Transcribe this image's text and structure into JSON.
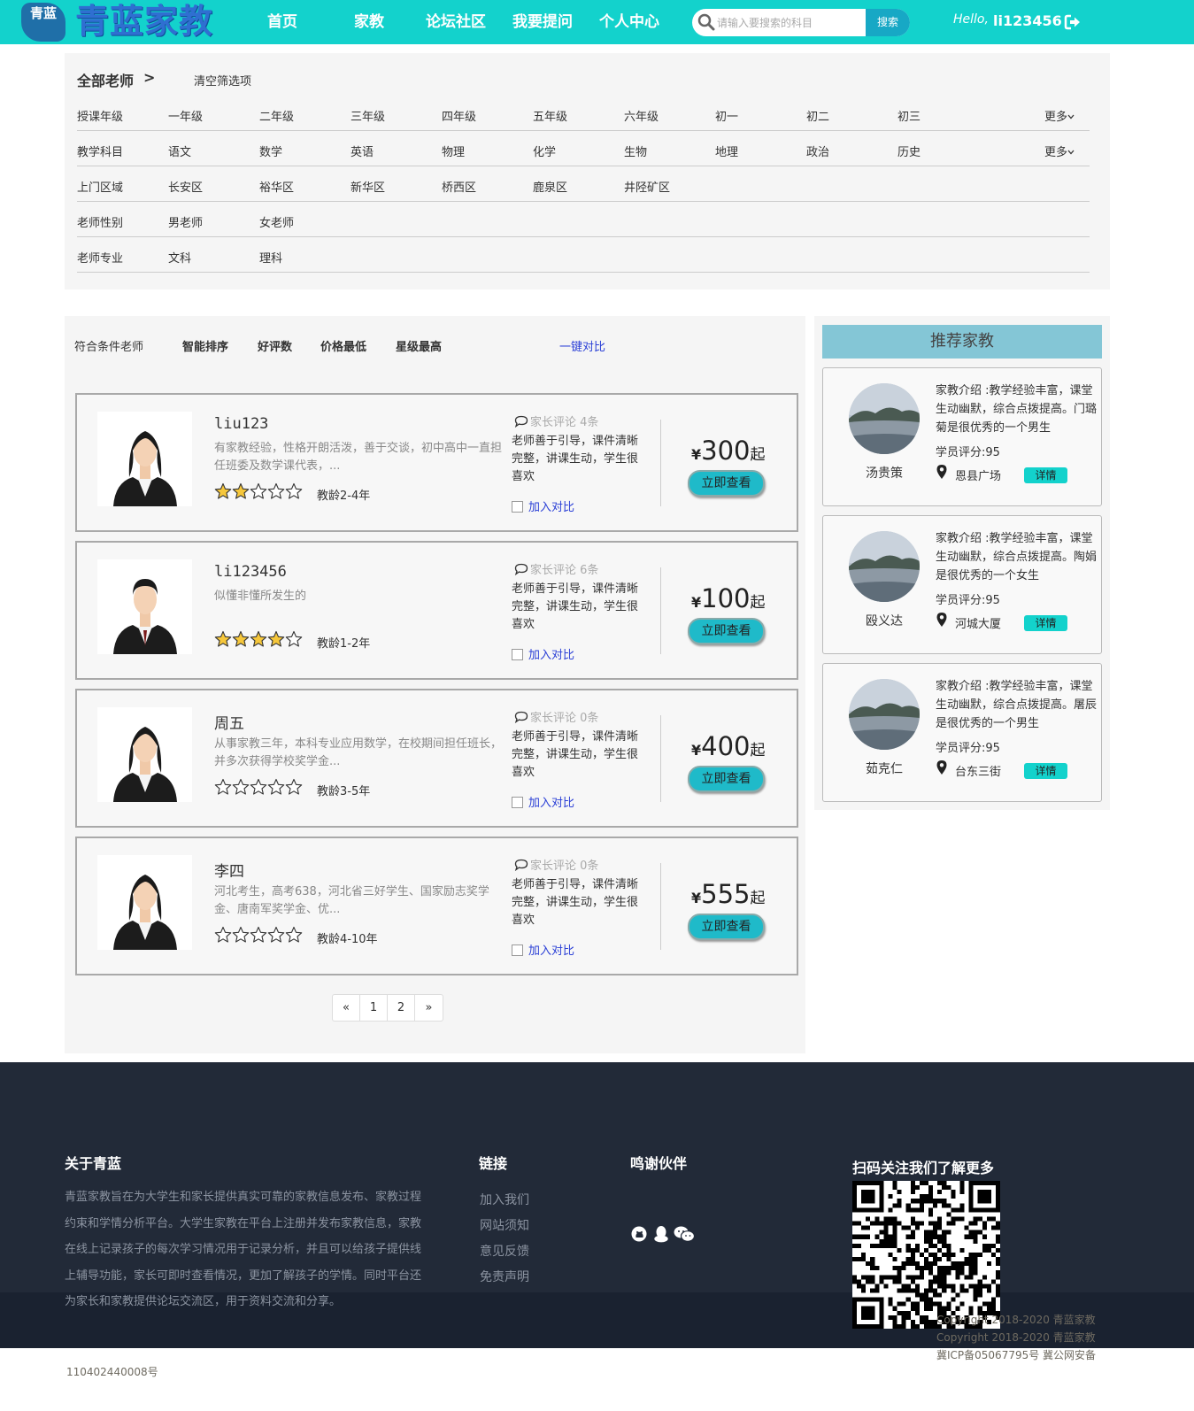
{
  "header": {
    "logo_badge": "青蓝",
    "logo_text": "青蓝家教",
    "nav": [
      "首页",
      "家教",
      "论坛社区",
      "我要提问",
      "个人中心"
    ],
    "search_placeholder": "请输入要搜索的科目",
    "search_button": "搜索",
    "hello": "Hello,",
    "username": "li123456",
    "colors": {
      "bar": "#13d2cc",
      "search_button": "#17a8c5"
    }
  },
  "filters": {
    "all_label": "全部老师",
    "arrow": ">",
    "clear": "清空筛选项",
    "more": "更多",
    "rows": [
      {
        "label": "授课年级",
        "options": [
          "一年级",
          "二年级",
          "三年级",
          "四年级",
          "五年级",
          "六年级",
          "初一",
          "初二",
          "初三"
        ],
        "has_more": true
      },
      {
        "label": "教学科目",
        "options": [
          "语文",
          "数学",
          "英语",
          "物理",
          "化学",
          "生物",
          "地理",
          "政治",
          "历史"
        ],
        "has_more": true
      },
      {
        "label": "上门区域",
        "options": [
          "长安区",
          "裕华区",
          "新华区",
          "桥西区",
          "鹿泉区",
          "井陉矿区"
        ],
        "has_more": false
      },
      {
        "label": "老师性别",
        "options": [
          "男老师",
          "女老师"
        ],
        "has_more": false
      },
      {
        "label": "老师专业",
        "options": [
          "文科",
          "理科"
        ],
        "has_more": false
      }
    ]
  },
  "list": {
    "sort_label": "符合条件老师",
    "sort_options": [
      "智能排序",
      "好评数",
      "价格最低",
      "星级最高"
    ],
    "compare_all": "一键对比",
    "review_prefix": "家长评论",
    "add_compare": "加入对比",
    "view_button": "立即查看",
    "yen": "¥",
    "qi": "起",
    "teachers": [
      {
        "name": "liu123",
        "desc": "有家教经验，性格开朗活泼，善于交谈，初中高中一直担任班委及数学课代表，...",
        "rating": 2,
        "age": "教龄2-4年",
        "reviews": "4条",
        "comment": "老师善于引导，课件清晰完整，讲课生动，学生很喜欢",
        "price": "300",
        "gender": "female"
      },
      {
        "name": "li123456",
        "desc": "似懂非懂所发生的",
        "rating": 4,
        "age": "教龄1-2年",
        "reviews": "6条",
        "comment": "老师善于引导，课件清晰完整，讲课生动，学生很喜欢",
        "price": "100",
        "gender": "male"
      },
      {
        "name": "周五",
        "desc": "从事家教三年，本科专业应用数学，在校期间担任班长，并多次获得学校奖学金...",
        "rating": 0,
        "age": "教龄3-5年",
        "reviews": "0条",
        "comment": "老师善于引导，课件清晰完整，讲课生动，学生很喜欢",
        "price": "400",
        "gender": "female"
      },
      {
        "name": "李四",
        "desc": "河北考生，高考638，河北省三好学生、国家励志奖学金、唐南军奖学金、优...",
        "rating": 0,
        "age": "教龄4-10年",
        "reviews": "0条",
        "comment": "老师善于引导，课件清晰完整，讲课生动，学生很喜欢",
        "price": "555",
        "gender": "female"
      }
    ],
    "pager": [
      "«",
      "1",
      "2",
      "»"
    ]
  },
  "recommend": {
    "title": "推荐家教",
    "detail_button": "详情",
    "items": [
      {
        "name": "汤贵策",
        "intro": "家教介绍 :教学经验丰富，课堂生动幽默，综合点拨提高。门璐菊是很优秀的一个男生",
        "score": "学员评分:95",
        "place": "恩县广场"
      },
      {
        "name": "殴义达",
        "intro": "家教介绍 :教学经验丰富，课堂生动幽默，综合点拨提高。陶娟是很优秀的一个女生",
        "score": "学员评分:95",
        "place": "河城大厦"
      },
      {
        "name": "茹克仁",
        "intro": "家教介绍 :教学经验丰富，课堂生动幽默，综合点拨提高。屠辰是很优秀的一个男生",
        "score": "学员评分:95",
        "place": "台东三街"
      }
    ]
  },
  "footer": {
    "about_title": "关于青蓝",
    "about_text": "青蓝家教旨在为大学生和家长提供真实可靠的家教信息发布、家教过程约束和学情分析平台。大学生家教在平台上注册并发布家教信息，家教在线上记录孩子的每次学习情况用于记录分析，并且可以给孩子提供线上辅导功能，家长可即时查看情况，更加了解孩子的学情。同时平台还为家长和家教提供论坛交流区，用于资料交流和分享。",
    "links_title": "链接",
    "links": [
      "加入我们",
      "网站须知",
      "意见反馈",
      "免责声明"
    ],
    "partners_title": "鸣谢伙伴",
    "social_icons": [
      "github-icon",
      "qq-icon",
      "wechat-icon"
    ],
    "qr_title": "扫码关注我们了解更多",
    "copyright_1": "Copyright 2018-2020   青蓝家教",
    "copyright_2": "Copyright 2018-2020   青蓝家教",
    "icp": "冀ICP备05067795号 冀公网安备",
    "icp_number": "110402440008号"
  }
}
